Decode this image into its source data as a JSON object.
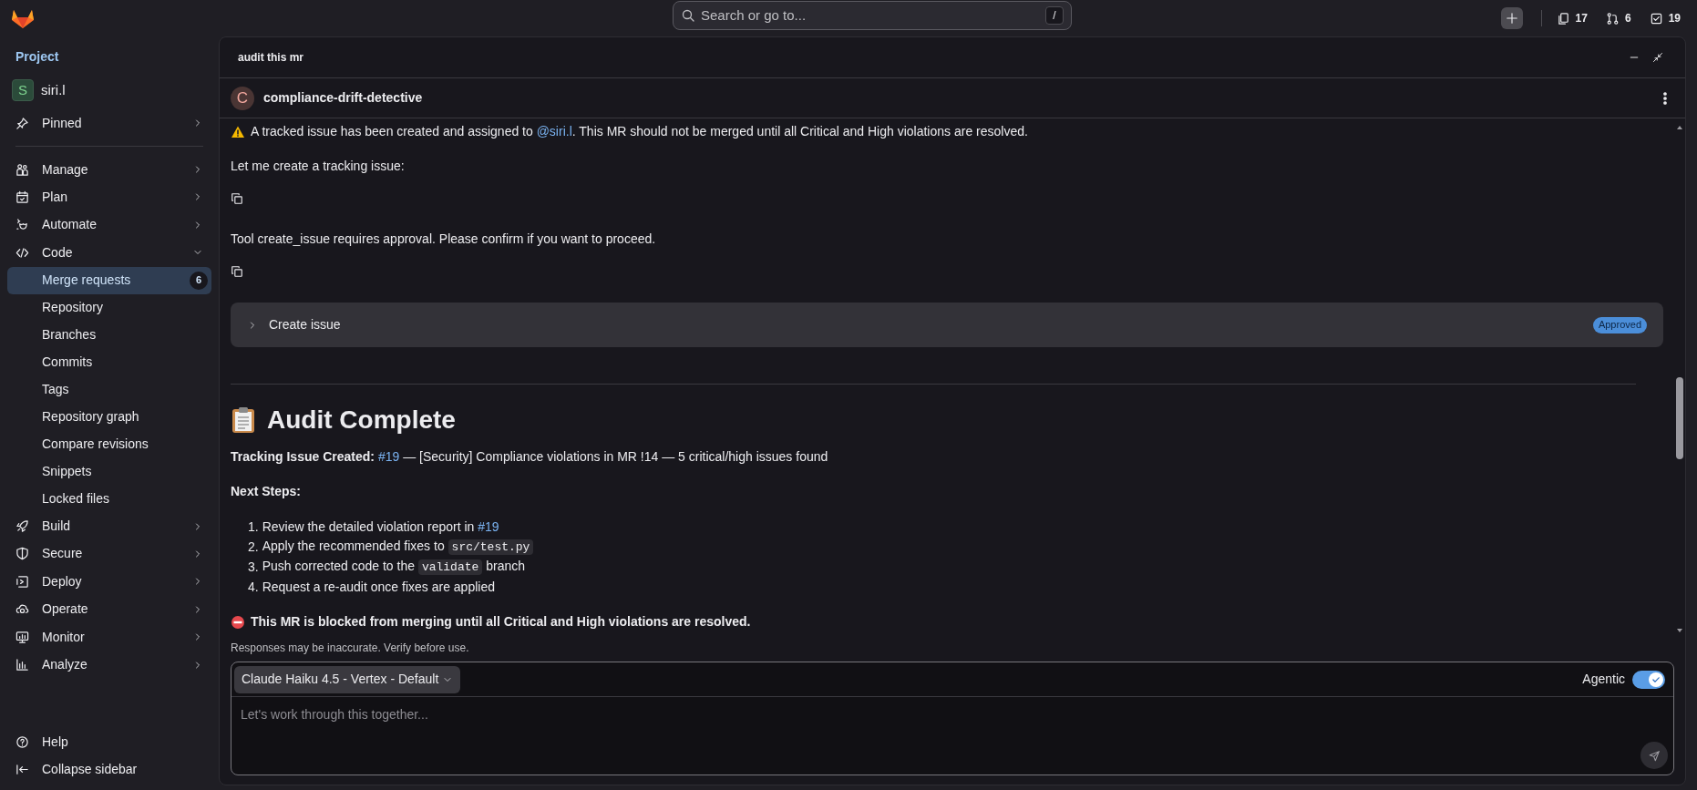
{
  "topbar": {
    "search_placeholder": "Search or go to...",
    "shortcut": "/",
    "counters": [
      {
        "kind": "issues",
        "count": "17"
      },
      {
        "kind": "merge_requests",
        "count": "6"
      },
      {
        "kind": "todos",
        "count": "19"
      }
    ]
  },
  "sidebar": {
    "heading": "Project",
    "project": {
      "initial": "S",
      "name": "siri.l"
    },
    "pinned": "Pinned",
    "sections": [
      {
        "label": "Manage",
        "expanded": false
      },
      {
        "label": "Plan",
        "expanded": false
      },
      {
        "label": "Automate",
        "expanded": false
      },
      {
        "label": "Code",
        "expanded": true,
        "children": [
          {
            "label": "Merge requests",
            "selected": true,
            "badge": "6"
          },
          {
            "label": "Repository",
            "selected": false
          },
          {
            "label": "Branches",
            "selected": false
          },
          {
            "label": "Commits",
            "selected": false
          },
          {
            "label": "Tags",
            "selected": false
          },
          {
            "label": "Repository graph",
            "selected": false
          },
          {
            "label": "Compare revisions",
            "selected": false
          },
          {
            "label": "Snippets",
            "selected": false
          },
          {
            "label": "Locked files",
            "selected": false
          }
        ]
      },
      {
        "label": "Build",
        "expanded": false
      },
      {
        "label": "Secure",
        "expanded": false
      },
      {
        "label": "Deploy",
        "expanded": false
      },
      {
        "label": "Operate",
        "expanded": false
      },
      {
        "label": "Monitor",
        "expanded": false
      },
      {
        "label": "Analyze",
        "expanded": false
      }
    ],
    "footer": [
      {
        "kind": "help",
        "label": "Help"
      },
      {
        "kind": "collapse",
        "label": "Collapse sidebar"
      }
    ]
  },
  "chat": {
    "title": "audit this mr",
    "agent": {
      "initial": "C",
      "name": "compliance-drift-detective"
    },
    "messages": [
      {
        "kind": "warning",
        "parts": [
          {
            "kind": "text",
            "text": "A tracked issue has been created and assigned to "
          },
          {
            "kind": "link",
            "text": "@siri.l"
          },
          {
            "kind": "text",
            "text": ". This MR should not be merged until all Critical and High violations are resolved."
          }
        ]
      },
      {
        "kind": "text",
        "parts": [
          {
            "kind": "text",
            "text": "Let me create a tracking issue:"
          }
        ]
      },
      {
        "kind": "copy"
      },
      {
        "kind": "text",
        "parts": [
          {
            "kind": "text",
            "text": "Tool create_issue requires approval. Please confirm if you want to proceed."
          }
        ]
      },
      {
        "kind": "copy"
      },
      {
        "kind": "tool",
        "label": "Create issue",
        "expanded": false,
        "status": "Approved"
      },
      {
        "kind": "divider"
      },
      {
        "kind": "heading",
        "text": "Audit Complete"
      },
      {
        "kind": "text",
        "parts": [
          {
            "kind": "bold",
            "text": "Tracking Issue Created:"
          },
          {
            "kind": "link",
            "text": "#19"
          },
          {
            "kind": "text",
            "text": " — [Security] Compliance violations in MR !14 — 5 critical/high issues found"
          }
        ]
      },
      {
        "kind": "text",
        "parts": [
          {
            "kind": "bold",
            "text": "Next Steps:"
          }
        ]
      },
      {
        "kind": "list",
        "items": [
          {
            "number": "1.",
            "parts": [
              {
                "kind": "text",
                "text": "Review the detailed violation report in "
              },
              {
                "kind": "link",
                "text": "#19"
              }
            ]
          },
          {
            "number": "2.",
            "parts": [
              {
                "kind": "text",
                "text": "Apply the recommended fixes to "
              },
              {
                "kind": "code",
                "text": "src/test.py"
              }
            ]
          },
          {
            "number": "3.",
            "parts": [
              {
                "kind": "text",
                "text": "Push corrected code to the "
              },
              {
                "kind": "code",
                "text": "validate"
              },
              {
                "kind": "text",
                "text": " branch"
              }
            ]
          },
          {
            "number": "4.",
            "parts": [
              {
                "kind": "text",
                "text": "Request a re-audit once fixes are applied"
              }
            ]
          }
        ]
      },
      {
        "kind": "alert",
        "parts": [
          {
            "kind": "bold",
            "text": "This MR is blocked from merging until all Critical and High violations are resolved."
          }
        ]
      }
    ],
    "disclaimer": "Responses may be inaccurate. Verify before use.",
    "input": {
      "model": "Claude Haiku 4.5 - Vertex - Default",
      "toggle_label": "Agentic",
      "agentic": true,
      "placeholder": "Let's work through this together..."
    }
  }
}
